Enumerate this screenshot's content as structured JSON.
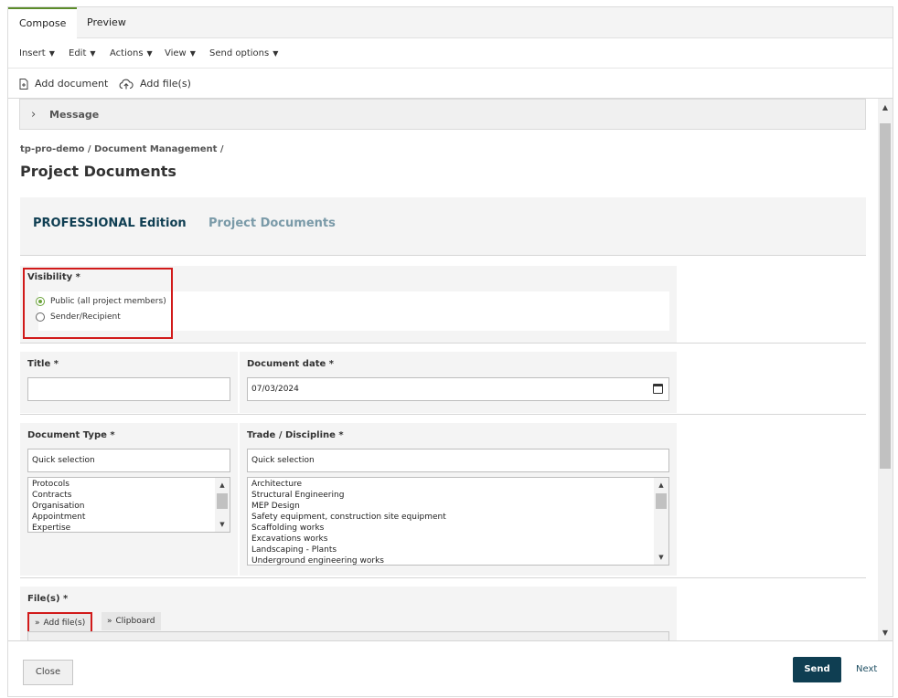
{
  "tabs": [
    {
      "label": "Compose",
      "active": true
    },
    {
      "label": "Preview",
      "active": false
    }
  ],
  "menu": {
    "insert": "Insert",
    "edit": "Edit",
    "actions": "Actions",
    "view": "View",
    "send_options": "Send options",
    "caret": "▼"
  },
  "toolbar": {
    "add_document": "Add document",
    "add_files": "Add file(s)"
  },
  "message": {
    "label": "Message",
    "chevron": "›"
  },
  "breadcrumb": "tp-pro-demo / Document Management /",
  "page_title": "Project Documents",
  "edition": {
    "strong": "PROFESSIONAL Edition",
    "light": "Project Documents"
  },
  "visibility": {
    "label": "Visibility *",
    "options": [
      {
        "label": "Public (all project members)",
        "selected": true
      },
      {
        "label": "Sender/Recipient",
        "selected": false
      }
    ]
  },
  "title_field": {
    "label": "Title *",
    "value": ""
  },
  "document_date": {
    "label": "Document date *",
    "value": "07/03/2024"
  },
  "document_type": {
    "label": "Document Type *",
    "quick_selection": "Quick selection",
    "options": [
      "Protocols",
      "Contracts",
      "Organisation",
      "Appointment",
      "Expertise"
    ]
  },
  "trade": {
    "label": "Trade / Discipline *",
    "quick_selection": "Quick selection",
    "options": [
      "Architecture",
      "Structural Engineering",
      "MEP Design",
      "Safety equipment, construction site equipment",
      "Scaffolding works",
      "Excavations works",
      "Landscaping - Plants",
      "Underground engineering works"
    ]
  },
  "files": {
    "label": "File(s) *",
    "add_files": "Add file(s)",
    "clipboard": "Clipboard",
    "button_icon": "»"
  },
  "footer": {
    "close": "Close",
    "send": "Send",
    "next": "Next"
  },
  "scroll_arrows": {
    "up": "▲",
    "down": "▼"
  },
  "icons": {
    "add_document": "document-plus-icon",
    "add_files": "cloud-upload-icon",
    "date_picker": "calendar-icon"
  },
  "colors": {
    "accent_green": "#5b8c2a",
    "radio_green": "#6ba33b",
    "primary_dark": "#0f3e52",
    "edition_light": "#7a9aa8",
    "highlight_red": "#d11a1a"
  }
}
